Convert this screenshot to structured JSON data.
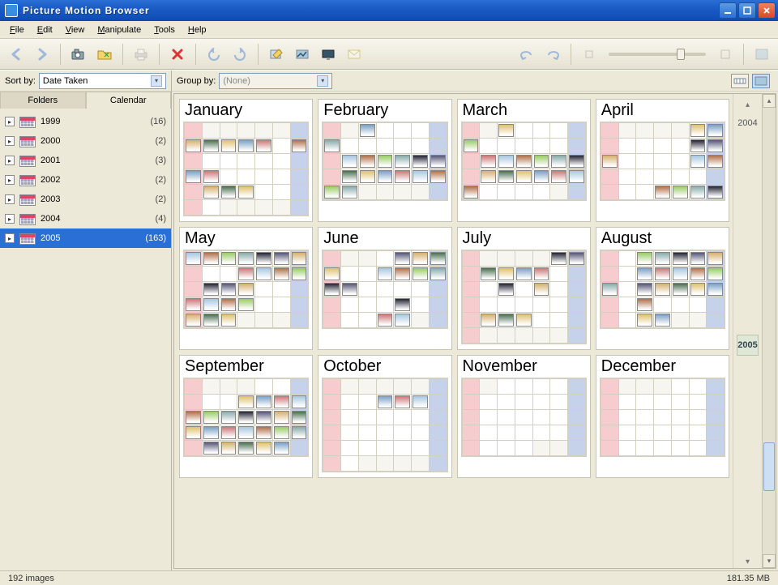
{
  "titlebar": {
    "title": "Picture Motion Browser"
  },
  "menus": {
    "file": "File",
    "edit": "Edit",
    "view": "View",
    "manipulate": "Manipulate",
    "tools": "Tools",
    "help": "Help"
  },
  "sortbar": {
    "label": "Sort by:",
    "value": "Date Taken"
  },
  "tabs": {
    "folders": "Folders",
    "calendar": "Calendar"
  },
  "years": [
    {
      "year": "1999",
      "count": "(16)",
      "selected": false
    },
    {
      "year": "2000",
      "count": "(2)",
      "selected": false
    },
    {
      "year": "2001",
      "count": "(3)",
      "selected": false
    },
    {
      "year": "2002",
      "count": "(2)",
      "selected": false
    },
    {
      "year": "2003",
      "count": "(2)",
      "selected": false
    },
    {
      "year": "2004",
      "count": "(4)",
      "selected": false
    },
    {
      "year": "2005",
      "count": "(163)",
      "selected": true
    }
  ],
  "groupbar": {
    "label": "Group by:",
    "value": "(None)"
  },
  "yearRail": {
    "prev": "2004",
    "current": "2005"
  },
  "months": [
    {
      "name": "January",
      "start": 6,
      "days": 31,
      "photos": [
        2,
        3,
        4,
        5,
        6,
        8,
        16,
        17,
        24,
        25,
        26
      ]
    },
    {
      "name": "February",
      "start": 2,
      "days": 28,
      "photos": [
        1,
        6,
        14,
        15,
        16,
        17,
        18,
        19,
        21,
        22,
        23,
        24,
        25,
        26,
        27,
        28
      ]
    },
    {
      "name": "March",
      "start": 2,
      "days": 31,
      "photos": [
        1,
        6,
        14,
        15,
        16,
        17,
        18,
        19,
        21,
        22,
        23,
        24,
        25,
        26,
        27
      ]
    },
    {
      "name": "April",
      "start": 5,
      "days": 30,
      "photos": [
        1,
        2,
        8,
        9,
        10,
        15,
        16,
        27,
        28,
        29,
        30
      ]
    },
    {
      "name": "May",
      "start": 0,
      "days": 31,
      "photos": [
        1,
        2,
        3,
        4,
        5,
        6,
        7,
        11,
        12,
        13,
        14,
        16,
        17,
        18,
        22,
        23,
        24,
        25,
        29,
        30,
        31
      ]
    },
    {
      "name": "June",
      "start": 3,
      "days": 30,
      "photos": [
        2,
        3,
        4,
        5,
        8,
        9,
        10,
        11,
        12,
        13,
        23,
        29,
        30
      ]
    },
    {
      "name": "July",
      "start": 5,
      "days": 31,
      "photos": [
        1,
        2,
        4,
        5,
        6,
        7,
        12,
        14,
        25,
        26,
        27
      ]
    },
    {
      "name": "August",
      "start": 1,
      "days": 31,
      "photos": [
        2,
        3,
        4,
        5,
        6,
        9,
        10,
        11,
        12,
        13,
        14,
        16,
        17,
        18,
        19,
        20,
        23,
        30,
        31
      ]
    },
    {
      "name": "September",
      "start": 4,
      "days": 30,
      "photos": [
        7,
        8,
        9,
        10,
        11,
        12,
        13,
        14,
        15,
        16,
        17,
        18,
        19,
        20,
        21,
        22,
        23,
        24,
        26,
        27,
        28,
        29,
        30
      ]
    },
    {
      "name": "October",
      "start": 6,
      "days": 31,
      "photos": [
        5,
        6,
        7
      ]
    },
    {
      "name": "November",
      "start": 2,
      "days": 30,
      "photos": []
    },
    {
      "name": "December",
      "start": 4,
      "days": 31,
      "photos": []
    }
  ],
  "thumb_palettes": [
    "#7aa0c4",
    "#9C6",
    "#d6b070",
    "#c77",
    "#8aa",
    "#4a6e50",
    "#a8c8e0",
    "#223",
    "#e0c070",
    "#b0704a",
    "#557"
  ],
  "status": {
    "images": "192 images",
    "size": "181.35 MB"
  }
}
